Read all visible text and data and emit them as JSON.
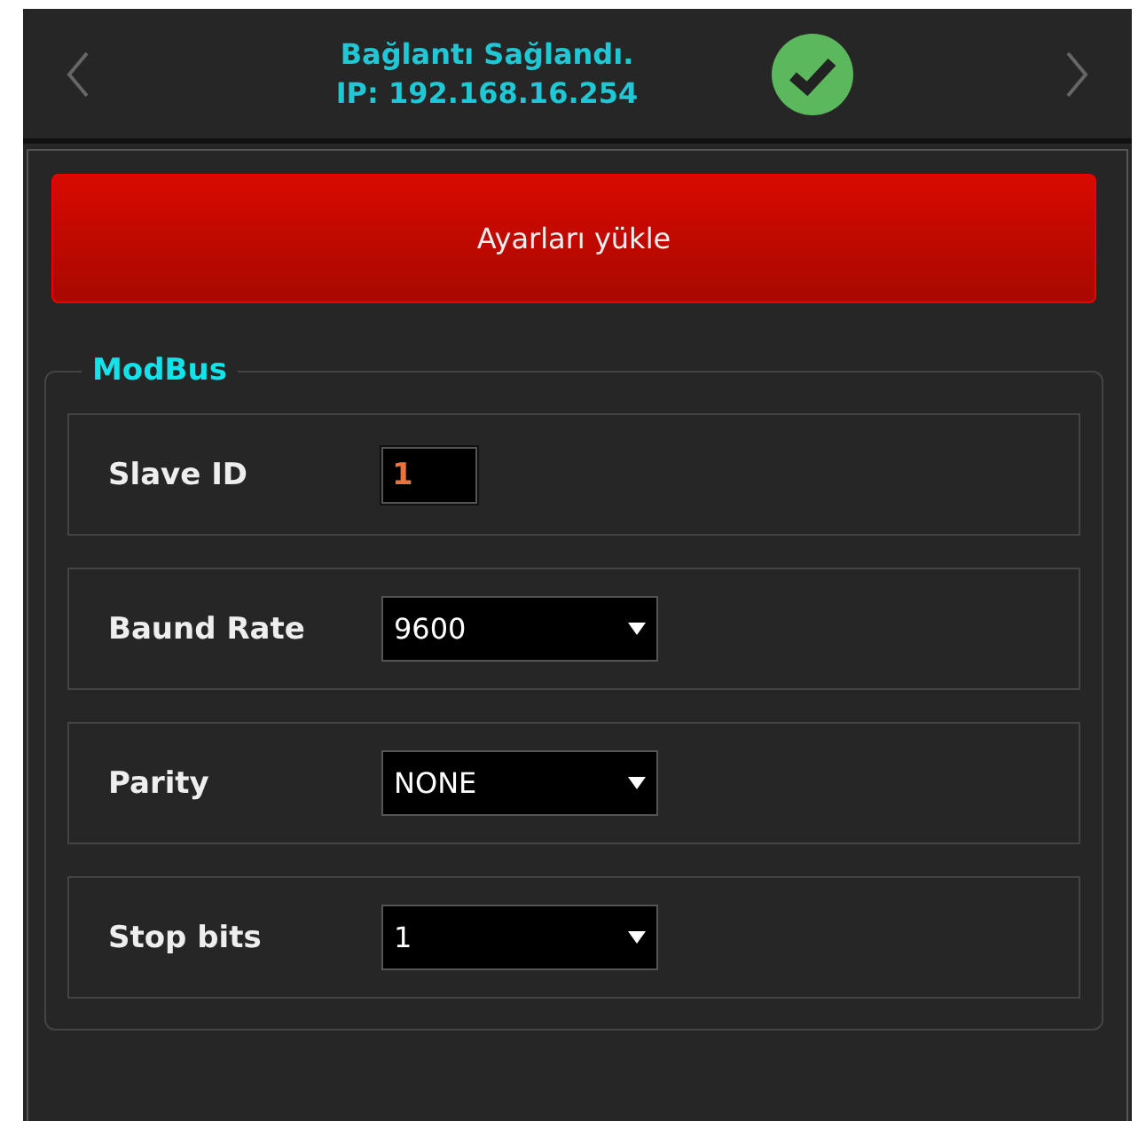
{
  "header": {
    "status_line": "Bağlantı Sağlandı.",
    "ip_line": "IP: 192.168.16.254",
    "connected": true
  },
  "load_button": "Ayarları yükle",
  "modbus": {
    "title": "ModBus",
    "rows": [
      {
        "label": "Slave ID",
        "kind": "text",
        "value": "1"
      },
      {
        "label": "Baund Rate",
        "kind": "select",
        "value": "9600"
      },
      {
        "label": "Parity",
        "kind": "select",
        "value": "NONE"
      },
      {
        "label": "Stop bits",
        "kind": "select",
        "value": "1"
      }
    ]
  }
}
